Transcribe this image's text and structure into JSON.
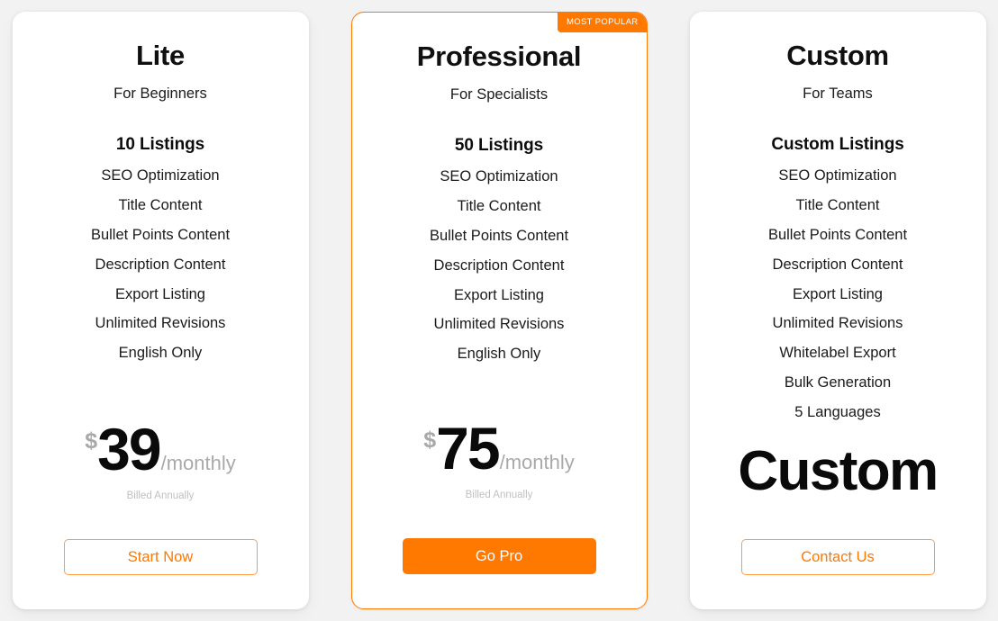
{
  "page": {
    "background_color": "#f2f2f2",
    "accent_color": "#ff7800"
  },
  "plans": [
    {
      "id": "lite",
      "name": "Lite",
      "tagline": "For Beginners",
      "headline_feature": "10 Listings",
      "features": [
        "SEO Optimization",
        "Title Content",
        "Bullet Points Content",
        "Description Content",
        "Export Listing",
        "Unlimited Revisions",
        "English Only"
      ],
      "currency": "$",
      "amount": "39",
      "period": "/monthly",
      "billing_note": "Billed Annually",
      "cta_label": "Start Now",
      "badge": null
    },
    {
      "id": "professional",
      "name": "Professional",
      "tagline": "For Specialists",
      "headline_feature": "50 Listings",
      "features": [
        "SEO Optimization",
        "Title Content",
        "Bullet Points Content",
        "Description Content",
        "Export Listing",
        "Unlimited Revisions",
        "English Only"
      ],
      "currency": "$",
      "amount": "75",
      "period": "/monthly",
      "billing_note": "Billed Annually",
      "cta_label": "Go Pro",
      "badge": "MOST POPULAR"
    },
    {
      "id": "custom",
      "name": "Custom",
      "tagline": "For Teams",
      "headline_feature": "Custom Listings",
      "features": [
        "SEO Optimization",
        "Title Content",
        "Bullet Points Content",
        "Description Content",
        "Export Listing",
        "Unlimited Revisions",
        "Whitelabel Export",
        "Bulk Generation",
        "5 Languages"
      ],
      "price_text": "Custom",
      "cta_label": "Contact Us",
      "badge": null
    }
  ]
}
